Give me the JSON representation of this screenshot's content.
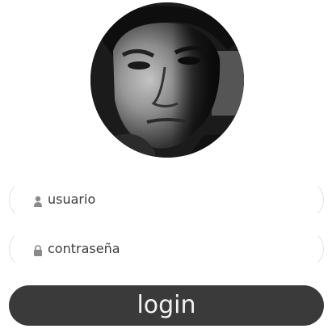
{
  "avatar": {
    "icon": "profile-photo"
  },
  "form": {
    "username": {
      "placeholder": "usuario",
      "icon": "user-icon"
    },
    "password": {
      "placeholder": "contraseña",
      "icon": "lock-icon"
    },
    "login_label": "login"
  },
  "colors": {
    "button_bg": "#3a3a3a",
    "button_text": "#f2f2f2",
    "field_border": "#d9e6ee",
    "icon": "#8a8a8a"
  }
}
